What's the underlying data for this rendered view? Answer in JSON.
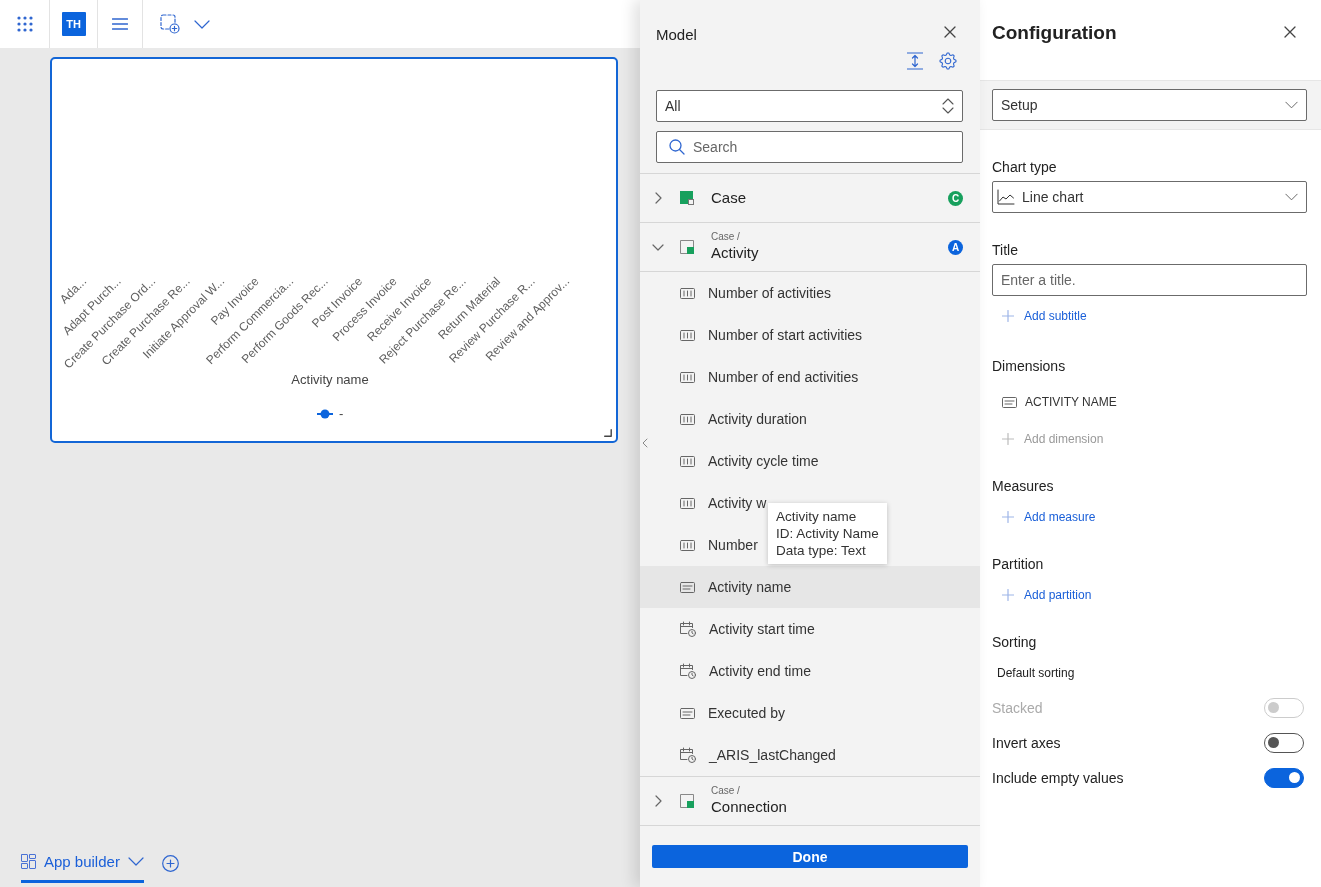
{
  "toolbar": {
    "avatar": "TH"
  },
  "chart_card": {
    "axis_labels": [
      "Ada...",
      "Adapt Purch...",
      "Create Purchase Ord...",
      "Create Purchase Re...",
      "Initiate Approval W...",
      "Pay Invoice",
      "Perform Commercia...",
      "Perform Goods Rec...",
      "Post Invoice",
      "Process Invoice",
      "Receive Invoice",
      "Reject Purchase Re...",
      "Return Material",
      "Review Purchase R...",
      "Review and Approv..."
    ],
    "axis_title": "Activity name",
    "legend": [
      {
        "label": "-",
        "color": "#0b64dd"
      }
    ]
  },
  "bottom_tabs": [
    {
      "label": "App builder",
      "selected": true
    }
  ],
  "model_panel": {
    "title": "Model",
    "filter": {
      "value": "All"
    },
    "search": {
      "placeholder": "Search"
    },
    "tree": [
      {
        "label": "Case",
        "kind": "case",
        "expanded": false,
        "badge": "C",
        "color": "#17a05d"
      },
      {
        "path": "Case /",
        "label": "Activity",
        "kind": "table",
        "expanded": true,
        "badge": "A",
        "color": "#0b64dd",
        "children": [
          {
            "label": "Number of activities",
            "kind": "number",
            "selected": false
          },
          {
            "label": "Number of start activities",
            "kind": "number",
            "selected": false
          },
          {
            "label": "Number of end activities",
            "kind": "number",
            "selected": false
          },
          {
            "label": "Activity duration",
            "kind": "number",
            "selected": false
          },
          {
            "label": "Activity cycle time",
            "kind": "number",
            "selected": false
          },
          {
            "label": "Activity w",
            "kind": "number",
            "selected": false
          },
          {
            "label": "Number",
            "kind": "number",
            "selected": false
          },
          {
            "label": "Activity name",
            "kind": "text",
            "selected": true
          },
          {
            "label": "Activity start time",
            "kind": "datetime",
            "selected": false
          },
          {
            "label": "Activity end time",
            "kind": "datetime",
            "selected": false
          },
          {
            "label": "Executed by",
            "kind": "text",
            "selected": false
          },
          {
            "label": "_ARIS_lastChanged",
            "kind": "datetime",
            "selected": false
          }
        ]
      },
      {
        "path": "Case /",
        "label": "Connection",
        "kind": "table",
        "expanded": false
      }
    ],
    "tooltip": {
      "lines": [
        "Activity name",
        "ID: Activity Name",
        "Data type: Text"
      ]
    },
    "done_button": "Done"
  },
  "configuration": {
    "title": "Configuration",
    "view_select": {
      "value": "Setup"
    },
    "chart_type": {
      "label": "Chart type",
      "value": "Line chart"
    },
    "title_field": {
      "label": "Title",
      "placeholder": "Enter a title."
    },
    "add_subtitle": {
      "label": "Add subtitle",
      "disabled": false
    },
    "sections": [
      {
        "heading": "Dimensions",
        "items": [
          {
            "label": "ACTIVITY NAME",
            "kind": "text"
          }
        ],
        "add": {
          "label": "Add dimension",
          "disabled": true
        }
      },
      {
        "heading": "Measures",
        "add": {
          "label": "Add measure",
          "disabled": false
        }
      },
      {
        "heading": "Partition",
        "add": {
          "label": "Add partition",
          "disabled": false
        }
      }
    ],
    "sorting": {
      "heading": "Sorting",
      "value": "Default sorting"
    },
    "toggles": [
      {
        "label": "Stacked",
        "on": false,
        "disabled": true
      },
      {
        "label": "Invert axes",
        "on": false,
        "disabled": false
      },
      {
        "label": "Include empty values",
        "on": true,
        "disabled": false
      }
    ]
  }
}
